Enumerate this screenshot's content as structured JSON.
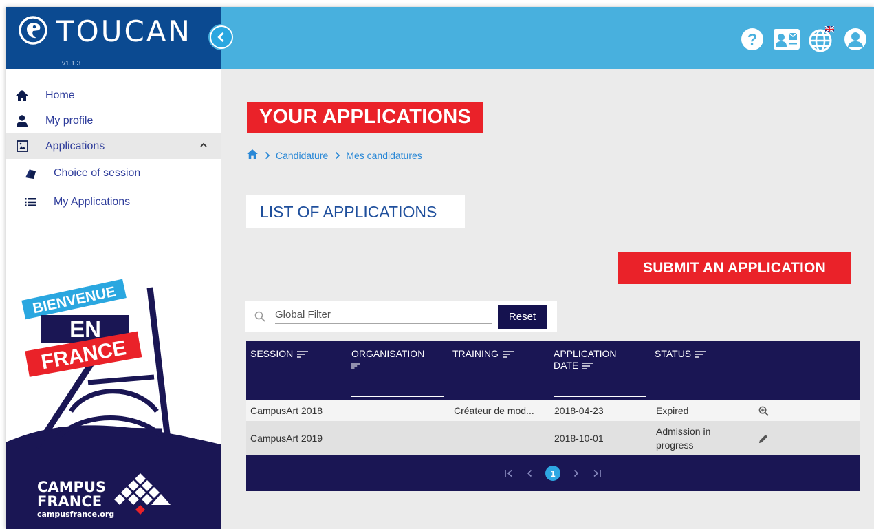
{
  "brand": {
    "title": "TOUCAN",
    "version": "v1.1.3"
  },
  "nav": {
    "home": "Home",
    "profile": "My profile",
    "applications": "Applications",
    "choice_of_session": "Choice of session",
    "my_applications": "My Applications"
  },
  "poster": {
    "line1": "BIENVENUE",
    "line2": "EN",
    "line3": "FRANCE",
    "org1": "CAMPUS",
    "org2": "FRANCE",
    "org_url": "campusfrance.org"
  },
  "page": {
    "title": "YOUR APPLICATIONS",
    "breadcrumb": [
      "Candidature",
      "Mes candidatures"
    ],
    "section_title": "LIST OF APPLICATIONS",
    "submit_label": "SUBMIT AN APPLICATION"
  },
  "filter": {
    "placeholder": "Global Filter",
    "reset_label": "Reset"
  },
  "table": {
    "columns": [
      "SESSION",
      "ORGANISATION",
      "TRAINING",
      "APPLICATION DATE",
      "STATUS"
    ],
    "rows": [
      {
        "session": "CampusArt 2018",
        "organisation": "",
        "training": "Créateur de mod...",
        "date": "2018-04-23",
        "status": "Expired",
        "action": "zoom-icon"
      },
      {
        "session": "CampusArt 2019",
        "organisation": "",
        "training": "",
        "date": "2018-10-01",
        "status": "Admission in progress",
        "action": "pencil-icon"
      }
    ],
    "current_page": "1"
  },
  "colors": {
    "brand_blue": "#0b4a91",
    "topbar": "#48b0de",
    "accent_red": "#ea2229",
    "table_navy": "#1a1654",
    "nav_text": "#2f3d9b"
  }
}
